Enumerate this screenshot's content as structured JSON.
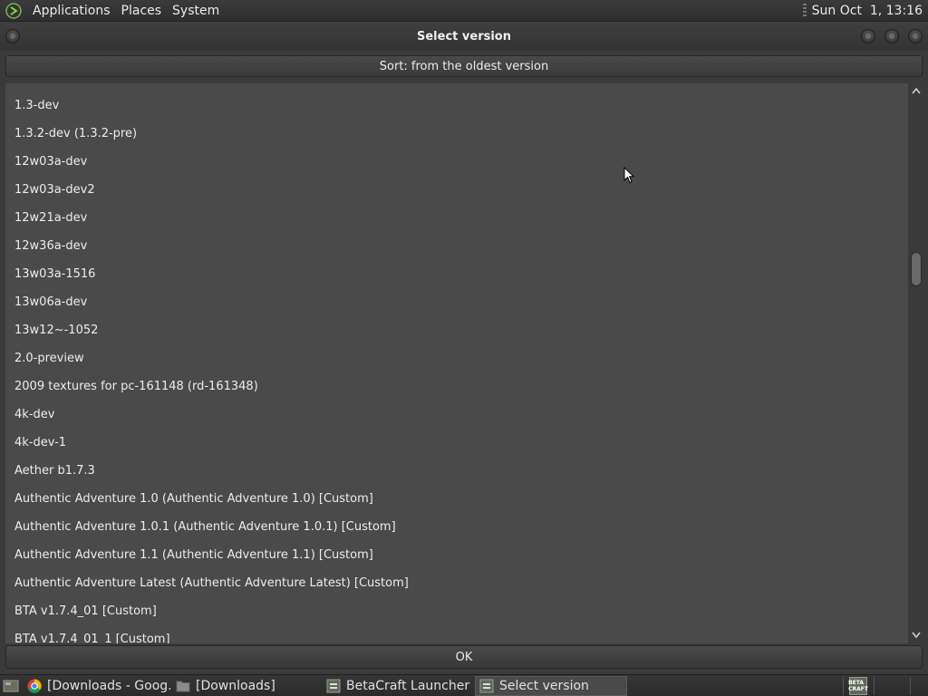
{
  "top_panel": {
    "menus": [
      "Applications",
      "Places",
      "System"
    ],
    "clock": "Sun Oct  1, 13:16"
  },
  "window": {
    "title": "Select version",
    "sort_label": "Sort: from the oldest version",
    "ok_label": "OK",
    "versions": [
      "1.3-dev",
      "1.3.2-dev (1.3.2-pre)",
      "12w03a-dev",
      "12w03a-dev2",
      "12w21a-dev",
      "12w36a-dev",
      "13w03a-1516",
      "13w06a-dev",
      "13w12~-1052",
      "2.0-preview",
      "2009 textures for pc-161148 (rd-161348)",
      "4k-dev",
      "4k-dev-1",
      "Aether b1.7.3",
      "Authentic Adventure 1.0 (Authentic Adventure 1.0) [Custom]",
      "Authentic Adventure 1.0.1 (Authentic Adventure 1.0.1) [Custom]",
      "Authentic Adventure 1.1 (Authentic Adventure 1.1) [Custom]",
      "Authentic Adventure Latest (Authentic Adventure Latest) [Custom]",
      "BTA v1.7.4_01 [Custom]",
      "BTA v1.7.4_01_1 [Custom]"
    ]
  },
  "taskbar": {
    "tasks": [
      {
        "label": "[Downloads - Goog...",
        "icon": "chrome-icon",
        "active": false
      },
      {
        "label": "[Downloads]",
        "icon": "folder-icon",
        "active": false
      },
      {
        "label": "BetaCraft Launcher ...",
        "icon": "betacraft-icon",
        "active": false
      },
      {
        "label": "Select version",
        "icon": "betacraft-icon",
        "active": true
      }
    ],
    "tray_icon_text": "BETA CRAFT"
  },
  "colors": {
    "background": "#3c3c3c",
    "list_background": "#4a4a4a",
    "text": "#ececec"
  }
}
